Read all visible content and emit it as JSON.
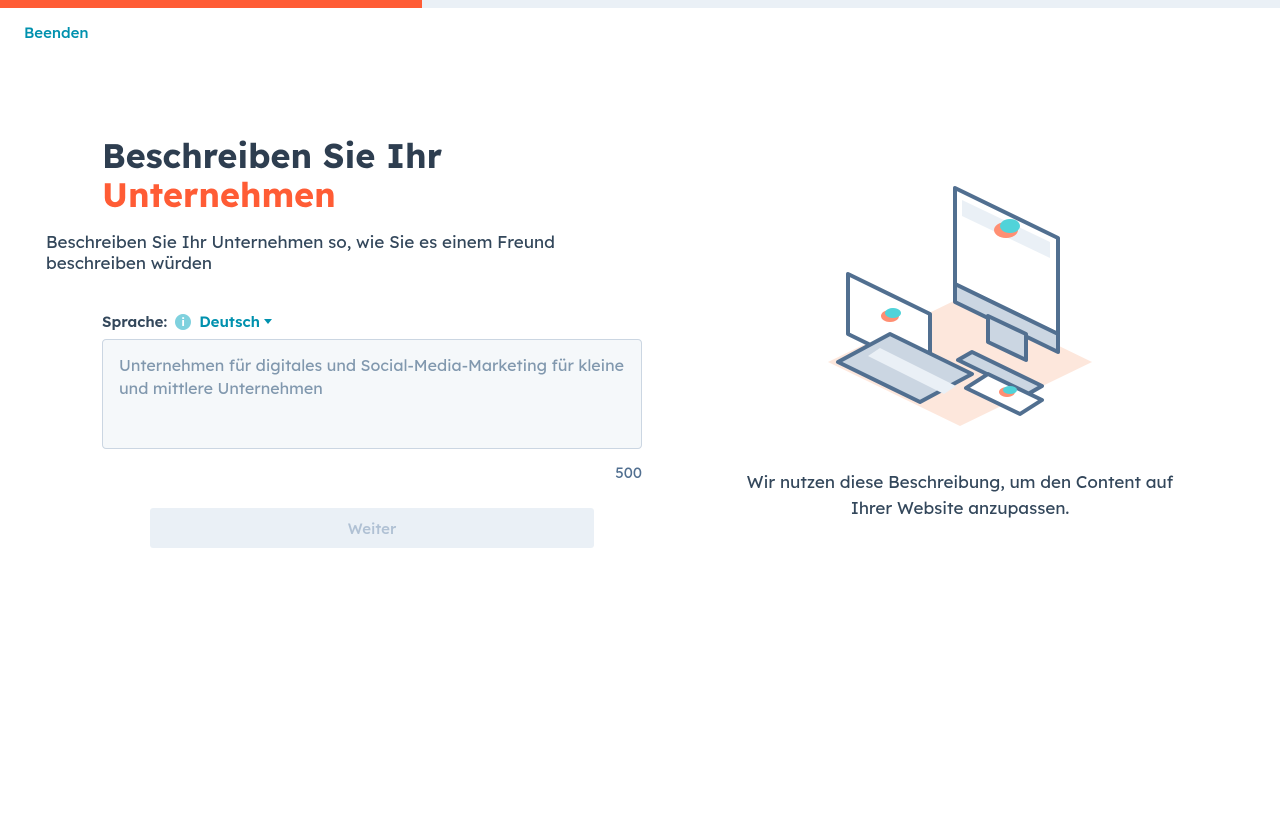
{
  "progress": {
    "percent": 33
  },
  "topbar": {
    "exit": "Beenden"
  },
  "heading": {
    "prefix": "Beschreiben Sie Ihr ",
    "accent": "Unternehmen"
  },
  "subheading": "Beschreiben Sie Ihr Unternehmen so, wie Sie es einem Freund beschreiben würden",
  "lang": {
    "label": "Sprache:",
    "selected": "Deutsch"
  },
  "textarea": {
    "placeholder": "Unternehmen für digitales und Social-Media-Marketing für kleine und mittlere Unternehmen",
    "value": "",
    "max_chars": "500"
  },
  "continue_btn": "Weiter",
  "right_caption": "Wir nutzen diese Beschreibung, um den Content auf Ihrer Website anzupassen."
}
